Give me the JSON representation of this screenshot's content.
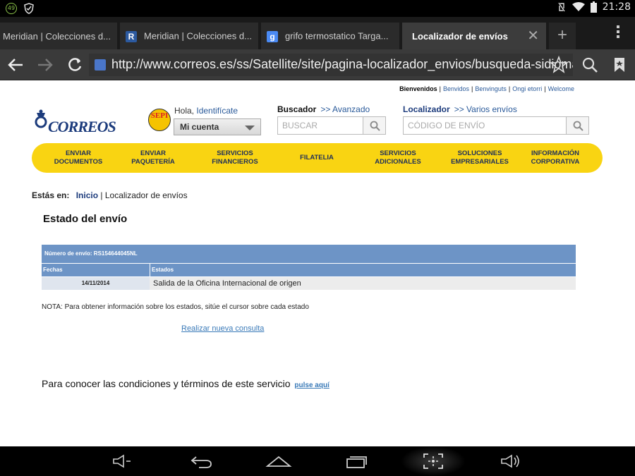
{
  "status_bar": {
    "badge": "49",
    "time": "21:28"
  },
  "tabs": [
    {
      "label": "Meridian | Colecciones d...",
      "favicon": ""
    },
    {
      "label": "Meridian | Colecciones d...",
      "favicon": "R"
    },
    {
      "label": "grifo termostatico Targa...",
      "favicon": "g"
    },
    {
      "label": "Localizador de envíos",
      "favicon": "",
      "active": true
    }
  ],
  "toolbar": {
    "url": "http://www.correos.es/ss/Satellite/site/pagina-localizador_envios/busqueda-sidioma=es"
  },
  "page": {
    "top_links": {
      "bienvenidos": "Bienvenidos",
      "items": [
        "Benvidos",
        "Benvinguts",
        "Ongi etorri",
        "Welcome"
      ]
    },
    "logo": "CORREOS",
    "sepi": "SEPI",
    "greeting": "Hola,",
    "identify_link": "Identifícate",
    "account": "Mi cuenta",
    "buscador": {
      "label": "Buscador",
      "link": ">> Avanzado",
      "placeholder": "BUSCAR"
    },
    "localizador": {
      "label": "Localizador",
      "link": ">> Varios envíos",
      "placeholder": "CÓDIGO DE ENVÍO"
    },
    "nav": [
      "ENVIAR DOCUMENTOS",
      "ENVIAR PAQUETERÍA",
      "SERVICIOS FINANCIEROS",
      "FILATELIA",
      "SERVICIOS ADICIONALES",
      "SOLUCIONES EMPRESARIALES",
      "INFORMACIÓN CORPORATIVA"
    ],
    "breadcrumb": {
      "label": "Estás en:",
      "home": "Inicio",
      "current": "Localizador de envíos"
    },
    "title": "Estado del envío",
    "table": {
      "shipment": "Número de envío: RS154644045NL",
      "col_dates": "Fechas",
      "col_states": "Estados",
      "rows": [
        {
          "date": "14/11/2014",
          "state": "Salida de la Oficina Internacional de origen"
        }
      ]
    },
    "note": "NOTA: Para obtener información sobre los estados, sitúe el cursor sobre cada estado",
    "new_query": "Realizar nueva consulta",
    "conditions_text": "Para conocer las condiciones y términos de este servicio",
    "conditions_link": "pulse aquí"
  }
}
